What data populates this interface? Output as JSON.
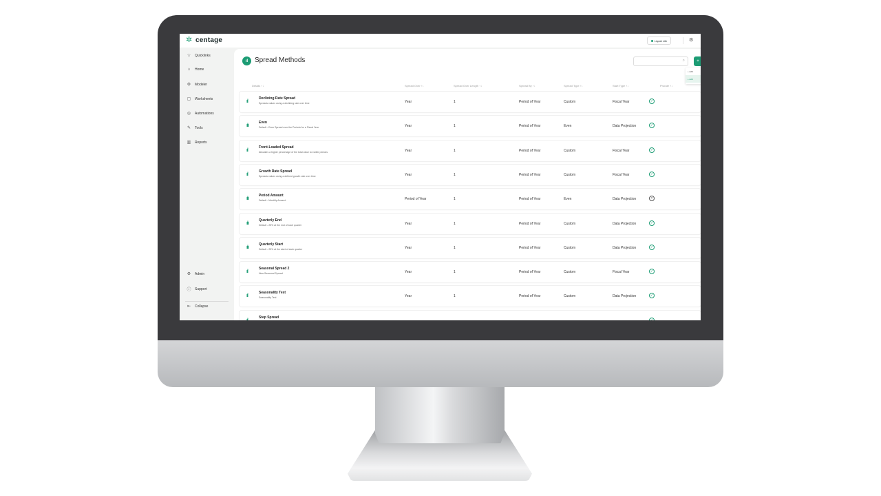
{
  "app": {
    "brand": "centage",
    "workspace": "Liquid Life"
  },
  "sidebar": {
    "items": [
      {
        "label": "Quicklinks",
        "icon": "star-icon"
      },
      {
        "label": "Home",
        "icon": "home-icon"
      },
      {
        "label": "Modeler",
        "icon": "modeler-icon"
      },
      {
        "label": "Worksheets",
        "icon": "worksheet-icon"
      },
      {
        "label": "Automations",
        "icon": "automation-icon"
      },
      {
        "label": "Tools",
        "icon": "tools-icon"
      },
      {
        "label": "Reports",
        "icon": "reports-icon"
      }
    ],
    "bottom": [
      {
        "label": "Admin",
        "icon": "gear-icon"
      },
      {
        "label": "Support",
        "icon": "help-icon"
      },
      {
        "label": "Collapse",
        "icon": "collapse-icon"
      }
    ]
  },
  "page": {
    "title": "Spread Methods",
    "add_menu": [
      "+ Add",
      "+ Add"
    ]
  },
  "table": {
    "headers": [
      "Details ↑↓",
      "Spread Over ↑↓",
      "Spread Over Length ↑↓",
      "Spread By ↑↓",
      "Spread Type ↑↓",
      "Start Type ↑↓",
      "Prorate ↑↓"
    ],
    "rows": [
      {
        "name": "Declining Rate Spread",
        "desc": "Spreads values using a declining rate over time",
        "over": "Year",
        "length": "1",
        "by": "Period of Year",
        "type": "Custom",
        "start": "Fiscal Year",
        "prorate": true
      },
      {
        "name": "Even",
        "desc": "Default - Even Spread over the Periods for a Fiscal Year",
        "over": "Year",
        "length": "1",
        "by": "Period of Year",
        "type": "Even",
        "start": "Data Projection",
        "prorate": true
      },
      {
        "name": "Front-Loaded Spread",
        "desc": "Allocates a higher percentage of the total value to earlier periods",
        "over": "Year",
        "length": "1",
        "by": "Period of Year",
        "type": "Custom",
        "start": "Fiscal Year",
        "prorate": true
      },
      {
        "name": "Growth Rate Spread",
        "desc": "Spreads values using a defined growth rate over time",
        "over": "Year",
        "length": "1",
        "by": "Period of Year",
        "type": "Custom",
        "start": "Fiscal Year",
        "prorate": true
      },
      {
        "name": "Period Amount",
        "desc": "Default - Monthly Amount",
        "over": "Period of Year",
        "length": "1",
        "by": "Period of Year",
        "type": "Even",
        "start": "Data Projection",
        "prorate": false
      },
      {
        "name": "Quarterly End",
        "desc": "Default - 25% at the end of each quarter",
        "over": "Year",
        "length": "1",
        "by": "Period of Year",
        "type": "Custom",
        "start": "Data Projection",
        "prorate": true
      },
      {
        "name": "Quarterly Start",
        "desc": "Default - 25% at the start of each quarter",
        "over": "Year",
        "length": "1",
        "by": "Period of Year",
        "type": "Custom",
        "start": "Data Projection",
        "prorate": true
      },
      {
        "name": "Seasonal Spread 2",
        "desc": "New Seasonal Spread",
        "over": "Year",
        "length": "1",
        "by": "Period of Year",
        "type": "Custom",
        "start": "Fiscal Year",
        "prorate": true
      },
      {
        "name": "Seasonality Test",
        "desc": "Seasonality Test",
        "over": "Year",
        "length": "1",
        "by": "Period of Year",
        "type": "Custom",
        "start": "Data Projection",
        "prorate": true
      },
      {
        "name": "Step Spread",
        "desc": "",
        "over": "",
        "length": "",
        "by": "",
        "type": "",
        "start": "",
        "prorate": true
      }
    ]
  },
  "colors": {
    "accent": "#1c9c74",
    "bezel": "#3a3a3d"
  }
}
